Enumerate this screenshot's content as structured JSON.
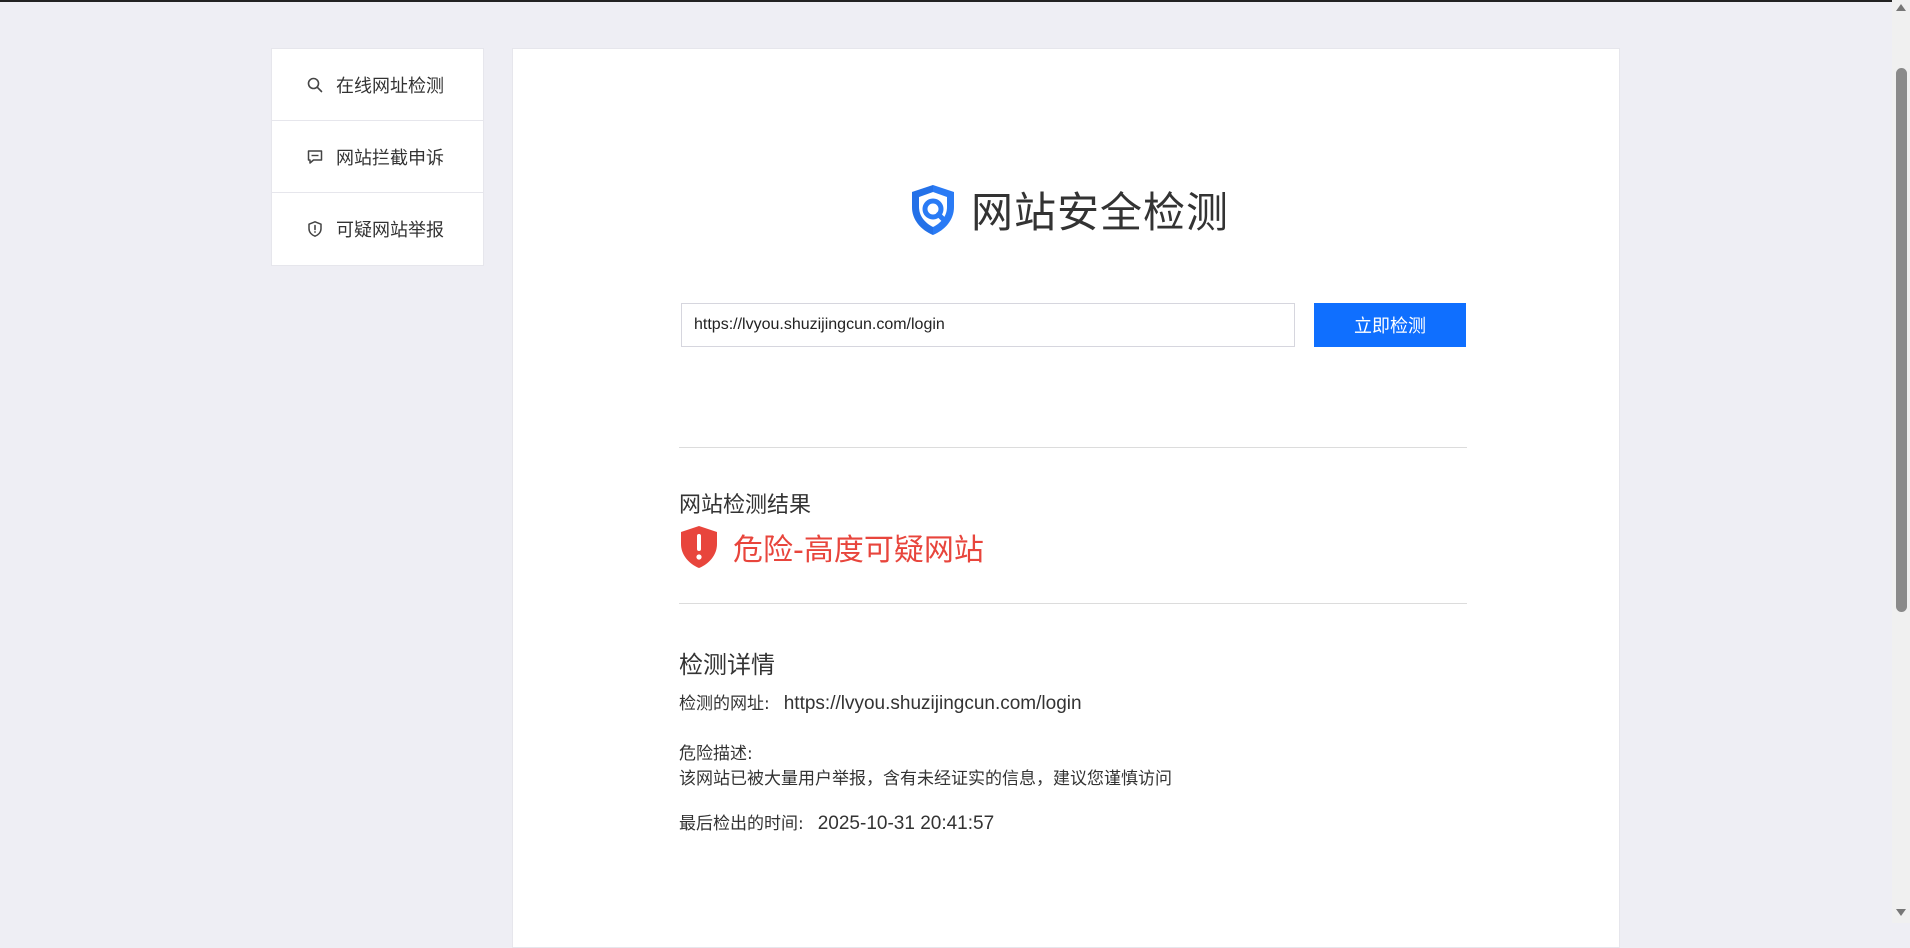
{
  "sidebar": {
    "items": [
      {
        "label": "在线网址检测",
        "icon": "search-icon"
      },
      {
        "label": "网站拦截申诉",
        "icon": "chat-icon"
      },
      {
        "label": "可疑网站举报",
        "icon": "shield-alert-icon"
      }
    ]
  },
  "brand": {
    "title": "网站安全检测"
  },
  "search": {
    "value": "https://lvyou.shuzijingcun.com/login",
    "button_label": "立即检测"
  },
  "result": {
    "title": "网站检测结果",
    "status": "危险-高度可疑网站",
    "status_color": "#e8453c"
  },
  "details": {
    "title": "检测详情",
    "url_label": "检测的网址:",
    "url_value": "https://lvyou.shuzijingcun.com/login",
    "risk_label": "危险描述:",
    "risk_text": "该网站已被大量用户举报，含有未经证实的信息，建议您谨慎访问",
    "time_label": "最后检出的时间:",
    "time_value": "2025-10-31 20:41:57"
  },
  "colors": {
    "accent": "#0f6fff",
    "danger": "#e8453c",
    "background": "#eeeef4"
  }
}
